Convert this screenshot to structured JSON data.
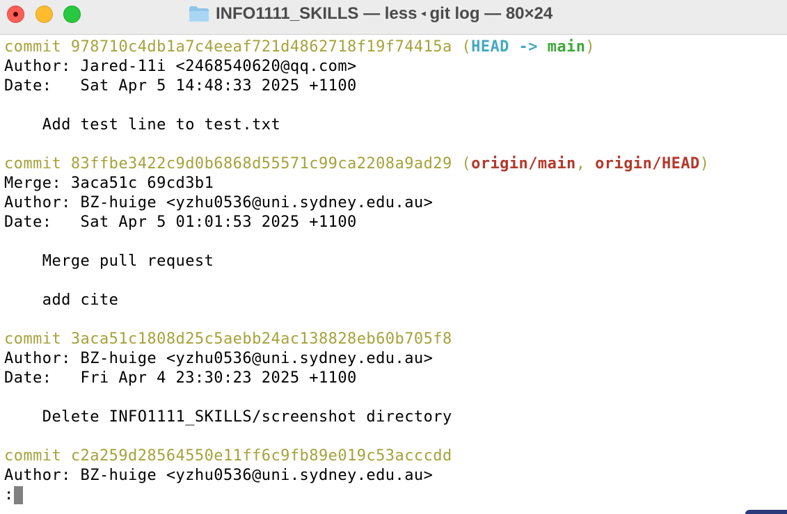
{
  "window": {
    "title": "INFO1111_SKILLS — less",
    "title_separator": "◂",
    "title_suffix": "git log — 80×24",
    "icon": "folder-icon"
  },
  "colors": {
    "commit_hash": "#a6a23b",
    "head": "#44a9c1",
    "branch": "#3ca83a",
    "remote": "#b5382a"
  },
  "log": {
    "c1": {
      "commit_prefix": "commit 978710c4db1a7c4eeaf721d4862718f19f74415a",
      "open_paren": " (",
      "head": "HEAD -> ",
      "branch": "main",
      "close_paren": ")",
      "author": "Author: Jared-11i <2468540620@qq.com>",
      "date": "Date:   Sat Apr 5 14:48:33 2025 +1100",
      "message": "    Add test line to test.txt"
    },
    "c2": {
      "commit_prefix": "commit 83ffbe3422c9d0b6868d55571c99ca2208a9ad29",
      "open_paren": " (",
      "remote1": "origin/main",
      "comma": ", ",
      "remote2": "origin/HEAD",
      "close_paren": ")",
      "merge": "Merge: 3aca51c 69cd3b1",
      "author": "Author: BZ-huige <yzhu0536@uni.sydney.edu.au>",
      "date": "Date:   Sat Apr 5 01:01:53 2025 +1100",
      "message1": "    Merge pull request",
      "message2": "    add cite"
    },
    "c3": {
      "commit_prefix": "commit 3aca51c1808d25c5aebb24ac138828eb60b705f8",
      "author": "Author: BZ-huige <yzhu0536@uni.sydney.edu.au>",
      "date": "Date:   Fri Apr 4 23:30:23 2025 +1100",
      "message": "    Delete INFO1111_SKILLS/screenshot directory"
    },
    "c4": {
      "commit_prefix": "commit c2a259d28564550e11ff6c9fb89e019c53acccdd",
      "author": "Author: BZ-huige <yzhu0536@uni.sydney.edu.au>"
    },
    "prompt": ":"
  }
}
